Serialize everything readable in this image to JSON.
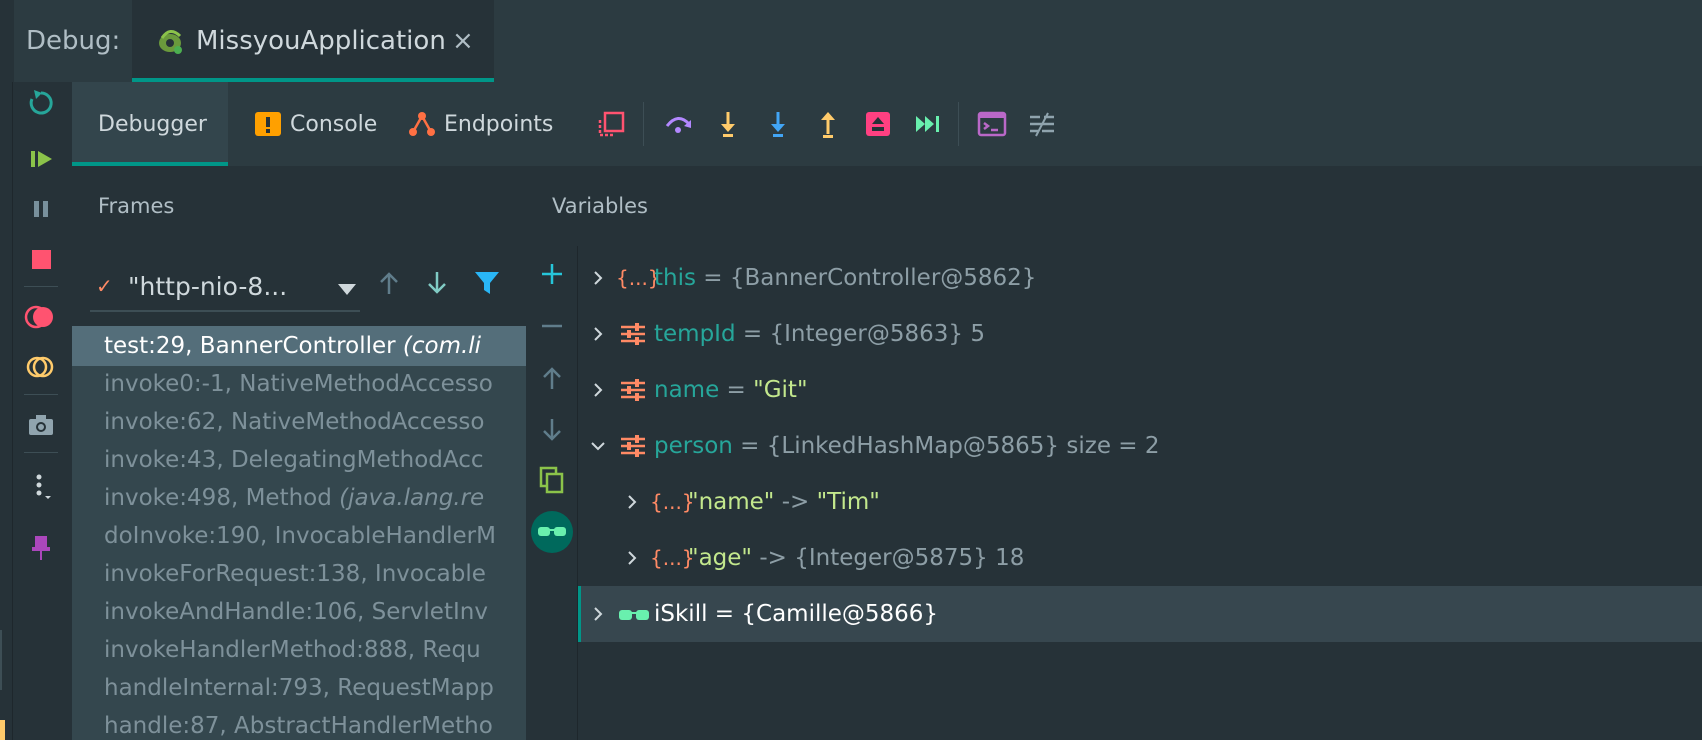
{
  "header": {
    "debug_label": "Debug:",
    "run_tab_title": "MissyouApplication",
    "close_glyph": "×"
  },
  "toolbar": {
    "tabs": [
      {
        "label": "Debugger",
        "icon": "debugger-tab"
      },
      {
        "label": "Console",
        "icon": "console-warning-icon"
      },
      {
        "label": "Endpoints",
        "icon": "endpoints-icon"
      }
    ],
    "actions": [
      "show-execution-point-icon",
      "step-over-icon",
      "step-into-icon",
      "force-step-into-icon",
      "step-out-icon",
      "drop-frame-icon",
      "run-to-cursor-icon",
      "evaluate-expression-icon",
      "trace-current-stream-icon"
    ]
  },
  "sidebar": {
    "icons": [
      "rerun-icon",
      "resume-icon",
      "pause-icon",
      "stop-icon",
      "view-breakpoints-icon",
      "mute-breakpoints-icon",
      "camera-icon",
      "more-icon",
      "pin-icon"
    ]
  },
  "frames": {
    "title": "Frames",
    "thread": "\"http-nio-8...",
    "items": [
      {
        "text": "test:29, BannerController ",
        "pkg": "(com.li"
      },
      {
        "text": "invoke0:-1, NativeMethodAccesso",
        "pkg": ""
      },
      {
        "text": "invoke:62, NativeMethodAccesso",
        "pkg": ""
      },
      {
        "text": "invoke:43, DelegatingMethodAcc",
        "pkg": ""
      },
      {
        "text": "invoke:498, Method ",
        "pkg": "(java.lang.re"
      },
      {
        "text": "doInvoke:190, InvocableHandlerM",
        "pkg": ""
      },
      {
        "text": "invokeForRequest:138, Invocable",
        "pkg": ""
      },
      {
        "text": "invokeAndHandle:106, ServletInv",
        "pkg": ""
      },
      {
        "text": "invokeHandlerMethod:888, Requ",
        "pkg": ""
      },
      {
        "text": "handleInternal:793, RequestMapp",
        "pkg": ""
      },
      {
        "text": "handle:87, AbstractHandlerMetho",
        "pkg": ""
      }
    ]
  },
  "variables": {
    "title": "Variables",
    "items": [
      {
        "name": "this",
        "eq": " = ",
        "value": "{BannerController@5862}",
        "icon": "object-icon"
      },
      {
        "name": "tempId",
        "eq": " = ",
        "value": "{Integer@5863} 5",
        "icon": "field-icon"
      },
      {
        "name": "name",
        "eq": " = ",
        "value": "\"Git\"",
        "icon": "field-icon"
      },
      {
        "name": "person",
        "eq": " = ",
        "value": "{LinkedHashMap@5865}  size = 2",
        "icon": "field-icon"
      },
      {
        "name": "\"name\"",
        "eq": " -> ",
        "value": "\"Tim\"",
        "icon": "entry-icon"
      },
      {
        "name": "\"age\"",
        "eq": " -> ",
        "value": "{Integer@5875} 18",
        "icon": "entry-icon"
      },
      {
        "name": "iSkill",
        "eq": " = ",
        "value": "{Camille@5866}",
        "icon": "watch-icon"
      }
    ]
  },
  "colors": {
    "accent": "#009688",
    "background": "#263238",
    "field_name": "#26a69a",
    "string_value": "#c3e88d",
    "stop_red": "#ff5370",
    "resume_green": "#8bc34a",
    "step_yellow": "#ffcb6b",
    "step_blue": "#42a5f5",
    "filter_blue": "#29b6f6"
  }
}
